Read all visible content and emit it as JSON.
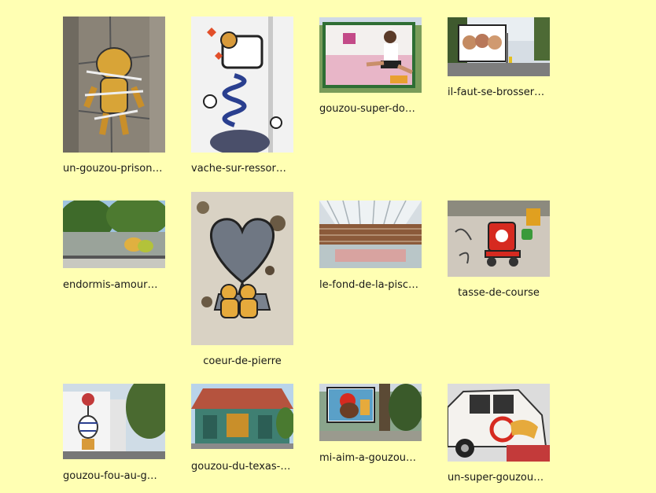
{
  "gallery": {
    "items": [
      {
        "caption": "un-gouzou-prison…"
      },
      {
        "caption": "vache-sur-ressor…"
      },
      {
        "caption": "gouzou-super-do…"
      },
      {
        "caption": "il-faut-se-brosser…"
      },
      {
        "caption": "endormis-amour…"
      },
      {
        "caption": "coeur-de-pierre"
      },
      {
        "caption": "le-fond-de-la-pisc…"
      },
      {
        "caption": "tasse-de-course"
      },
      {
        "caption": "gouzou-fou-au-g…"
      },
      {
        "caption": "gouzou-du-texas-…"
      },
      {
        "caption": "mi-aim-a-gouzou…"
      },
      {
        "caption": "un-super-gouzou…"
      }
    ]
  }
}
